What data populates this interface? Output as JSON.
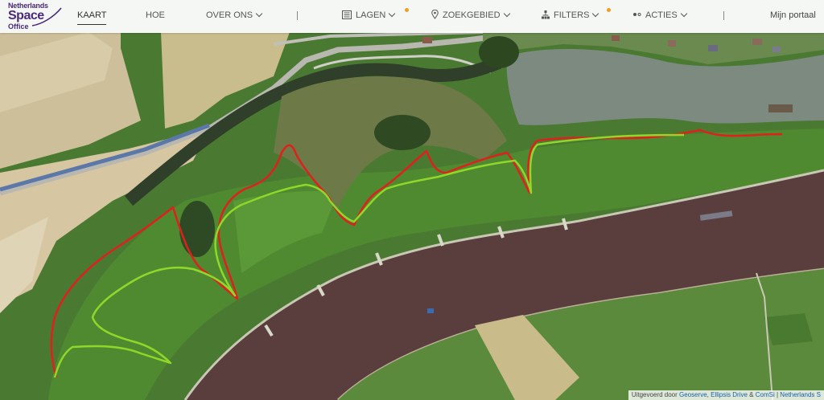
{
  "logo": {
    "line1": "Netherlands",
    "line2": "Space",
    "line3": "Office"
  },
  "nav": {
    "kaart": "KAART",
    "hoe": "HOE",
    "over_ons": "OVER ONS",
    "lagen": "LAGEN",
    "zoekgebied": "ZOEKGEBIED",
    "filters": "FILTERS",
    "acties": "ACTIES",
    "mijn_portaal": "Mijn portaal"
  },
  "icons": {
    "lagen": "layers-icon",
    "zoekgebied": "location-pin-icon",
    "filters": "filter-tree-icon",
    "acties": "actions-icon"
  },
  "colors": {
    "brand": "#4a2a7a",
    "indicator": "#f0a020",
    "line_red": "#e0201c",
    "line_green": "#8fd82a"
  },
  "attribution": {
    "prefix": "Uitgevoerd door",
    "link1": "Geoserve",
    "link2": "Ellipsis Drive",
    "amp": "&",
    "link3": "ComSi",
    "sep": "|",
    "link4": "Netherlands S"
  }
}
